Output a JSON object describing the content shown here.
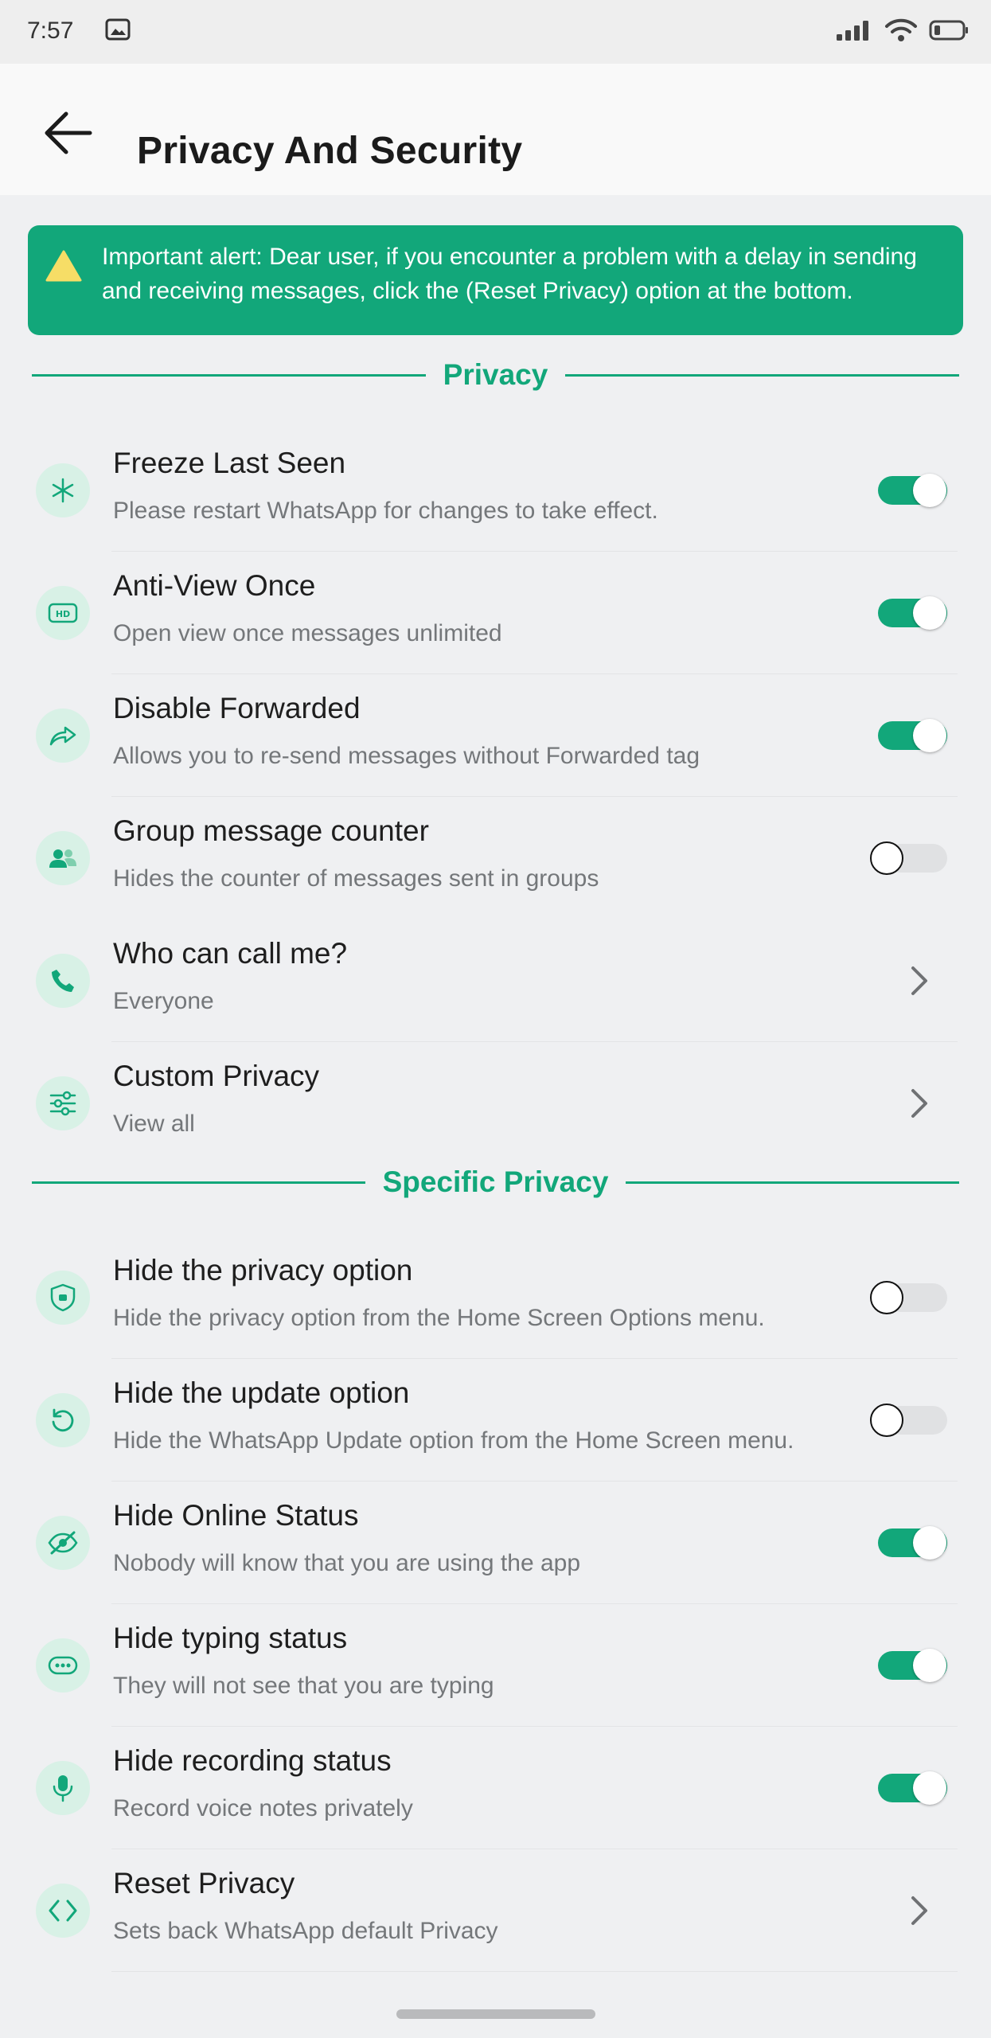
{
  "status_bar": {
    "time": "7:57"
  },
  "header": {
    "title": "Privacy And Security"
  },
  "alert": {
    "text": "Important alert: Dear user, if you encounter a problem with a delay in sending and receiving messages, click the (Reset Privacy) option at the bottom."
  },
  "sections": {
    "privacy": {
      "title": "Privacy"
    },
    "specific": {
      "title": "Specific Privacy"
    }
  },
  "privacy_items": [
    {
      "title": "Freeze Last Seen",
      "subtitle": "Please restart WhatsApp for changes to take effect.",
      "control": "toggle",
      "enabled": true,
      "icon": "snowflake-icon"
    },
    {
      "title": "Anti-View Once",
      "subtitle": "Open view once messages unlimited",
      "control": "toggle",
      "enabled": true,
      "icon": "hd-badge-icon"
    },
    {
      "title": "Disable Forwarded",
      "subtitle": "Allows you to re-send messages without Forwarded tag",
      "control": "toggle",
      "enabled": true,
      "icon": "forward-arrow-icon"
    },
    {
      "title": "Group message counter",
      "subtitle": "Hides the counter of messages sent in groups",
      "control": "toggle",
      "enabled": false,
      "icon": "group-icon"
    },
    {
      "title": "Who can call me?",
      "subtitle": "Everyone",
      "control": "chevron",
      "icon": "phone-icon"
    },
    {
      "title": "Custom Privacy",
      "subtitle": "View all",
      "control": "chevron",
      "icon": "sliders-icon"
    }
  ],
  "specific_items": [
    {
      "title": "Hide the privacy option",
      "subtitle": "Hide the privacy option from the Home Screen Options menu.",
      "control": "toggle",
      "enabled": false,
      "icon": "shield-icon"
    },
    {
      "title": "Hide the update option",
      "subtitle": "Hide the WhatsApp Update option from the Home Screen menu.",
      "control": "toggle",
      "enabled": false,
      "icon": "refresh-icon"
    },
    {
      "title": "Hide Online Status",
      "subtitle": "Nobody will know that you are using the app",
      "control": "toggle",
      "enabled": true,
      "icon": "eye-off-icon"
    },
    {
      "title": "Hide typing status",
      "subtitle": "They will not see that you are typing",
      "control": "toggle",
      "enabled": true,
      "icon": "typing-bubble-icon"
    },
    {
      "title": "Hide recording status",
      "subtitle": "Record voice notes privately",
      "control": "toggle",
      "enabled": true,
      "icon": "microphone-icon"
    },
    {
      "title": "Reset Privacy",
      "subtitle": "Sets back WhatsApp default Privacy",
      "control": "chevron",
      "icon": "code-brackets-icon"
    }
  ],
  "colors": {
    "accent": "#12a77a",
    "icon_bg": "#d8f1e6",
    "background": "#eff0f2"
  }
}
